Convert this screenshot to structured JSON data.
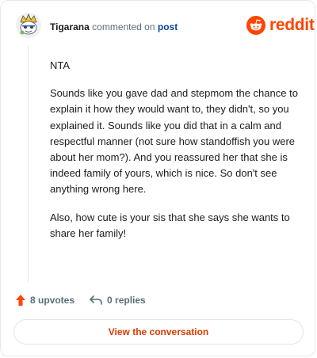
{
  "header": {
    "username": "Tigarana",
    "action_text": "commented on",
    "post_link": "post",
    "logo_text": "reddit"
  },
  "comment": {
    "paragraphs": [
      "NTA",
      "Sounds like you gave dad and stepmom the chance to explain it how they would want to, they didn't, so you explained it. Sounds like you did that in a calm and respectful manner (not sure how standoffish you were about her mom?). And you reassured her that she is indeed family of yours, which is nice. So don't see anything wrong here.",
      "Also, how cute is your sis that she says she wants to share her family!"
    ]
  },
  "actions": {
    "upvotes": "8 upvotes",
    "replies": "0 replies"
  },
  "cta": {
    "label": "View the conversation"
  },
  "colors": {
    "brand": "#ff4500",
    "link": "#0a449b",
    "cta_text": "#d93a00",
    "muted": "#576f76"
  },
  "icons": {
    "avatar": "snoo-avatar",
    "logo": "reddit-snoo-icon",
    "upvote": "upvote-arrow-icon",
    "reply": "reply-arrow-icon"
  }
}
